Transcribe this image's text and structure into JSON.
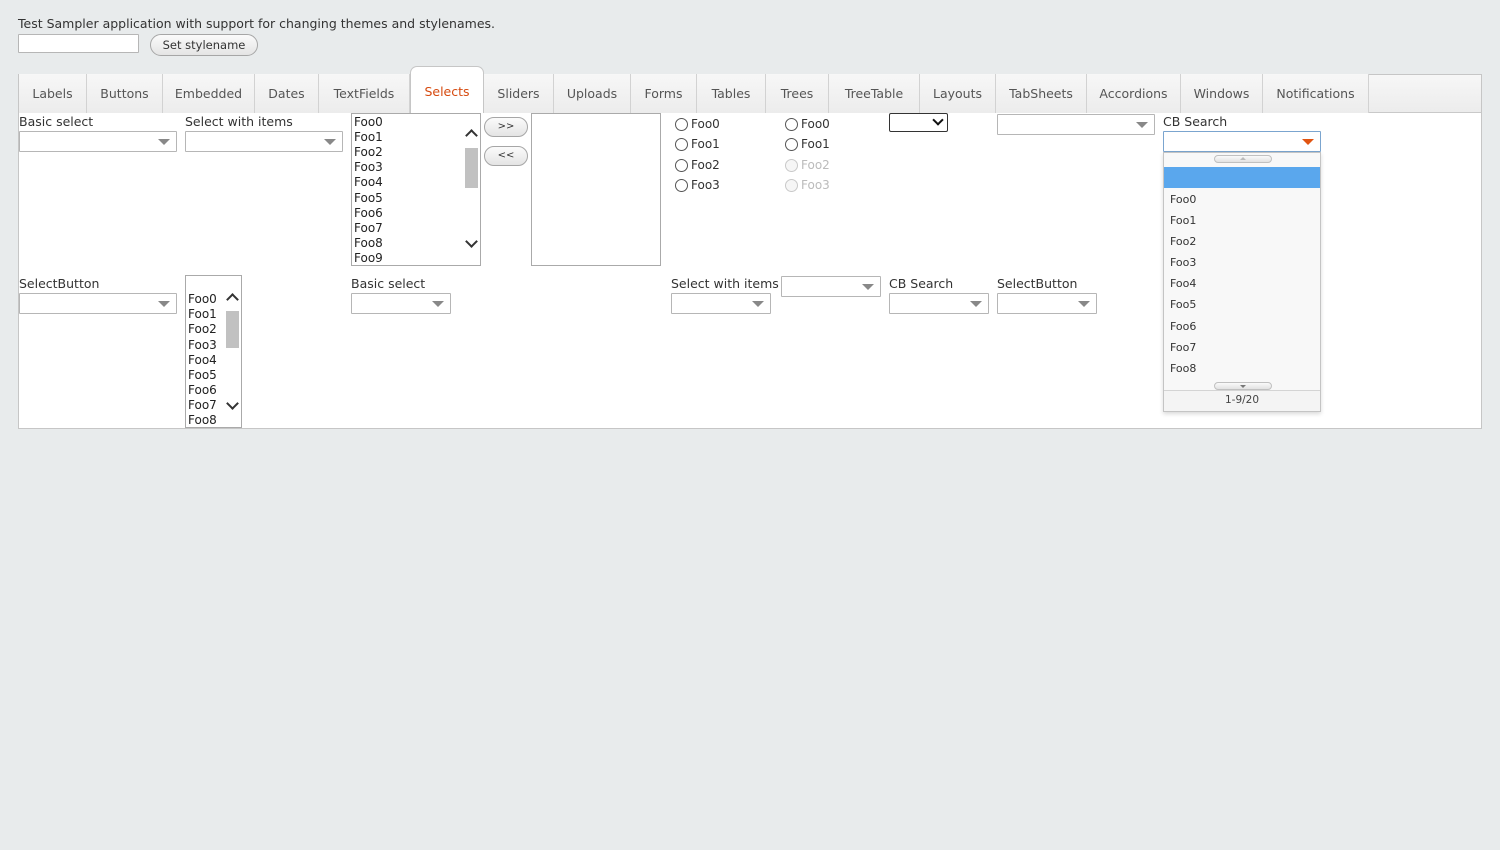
{
  "header": {
    "description": "Test Sampler application with support for changing themes and stylenames.",
    "stylename_input": "",
    "set_stylename_label": "Set stylename"
  },
  "tabs": [
    {
      "label": "Labels",
      "selected": false
    },
    {
      "label": "Buttons",
      "selected": false
    },
    {
      "label": "Embedded",
      "selected": false
    },
    {
      "label": "Dates",
      "selected": false
    },
    {
      "label": "TextFields",
      "selected": false
    },
    {
      "label": "Selects",
      "selected": true
    },
    {
      "label": "Sliders",
      "selected": false
    },
    {
      "label": "Uploads",
      "selected": false
    },
    {
      "label": "Forms",
      "selected": false
    },
    {
      "label": "Tables",
      "selected": false
    },
    {
      "label": "Trees",
      "selected": false
    },
    {
      "label": "TreeTable",
      "selected": false
    },
    {
      "label": "Layouts",
      "selected": false
    },
    {
      "label": "TabSheets",
      "selected": false
    },
    {
      "label": "Accordions",
      "selected": false
    },
    {
      "label": "Windows",
      "selected": false
    },
    {
      "label": "Notifications",
      "selected": false
    }
  ],
  "row1": {
    "basic_select_label": "Basic select",
    "select_with_items_label": "Select with items",
    "list_items": [
      "Foo0",
      "Foo1",
      "Foo2",
      "Foo3",
      "Foo4",
      "Foo5",
      "Foo6",
      "Foo7",
      "Foo8",
      "Foo9"
    ],
    "twin_add_label": ">>",
    "twin_remove_label": "<<",
    "radio_group_1": [
      "Foo0",
      "Foo1",
      "Foo2",
      "Foo3"
    ],
    "radio_group_2": [
      "Foo0",
      "Foo1",
      "Foo2",
      "Foo3"
    ],
    "cb_search_label": "CB Search"
  },
  "row2": {
    "select_button_label": "SelectButton",
    "list_items": [
      "Foo0",
      "Foo1",
      "Foo2",
      "Foo3",
      "Foo4",
      "Foo5",
      "Foo6",
      "Foo7",
      "Foo8"
    ],
    "basic_select_label": "Basic select",
    "select_with_items_label": "Select with items",
    "cb_search_label": "CB Search",
    "select_button_label_2": "SelectButton"
  },
  "popup": {
    "items": [
      "",
      "Foo0",
      "Foo1",
      "Foo2",
      "Foo3",
      "Foo4",
      "Foo5",
      "Foo6",
      "Foo7",
      "Foo8"
    ],
    "status": "1-9/20"
  },
  "colors": {
    "accent": "#d64a0f",
    "selection": "#5aa7ed",
    "background": "#e8ebec"
  }
}
